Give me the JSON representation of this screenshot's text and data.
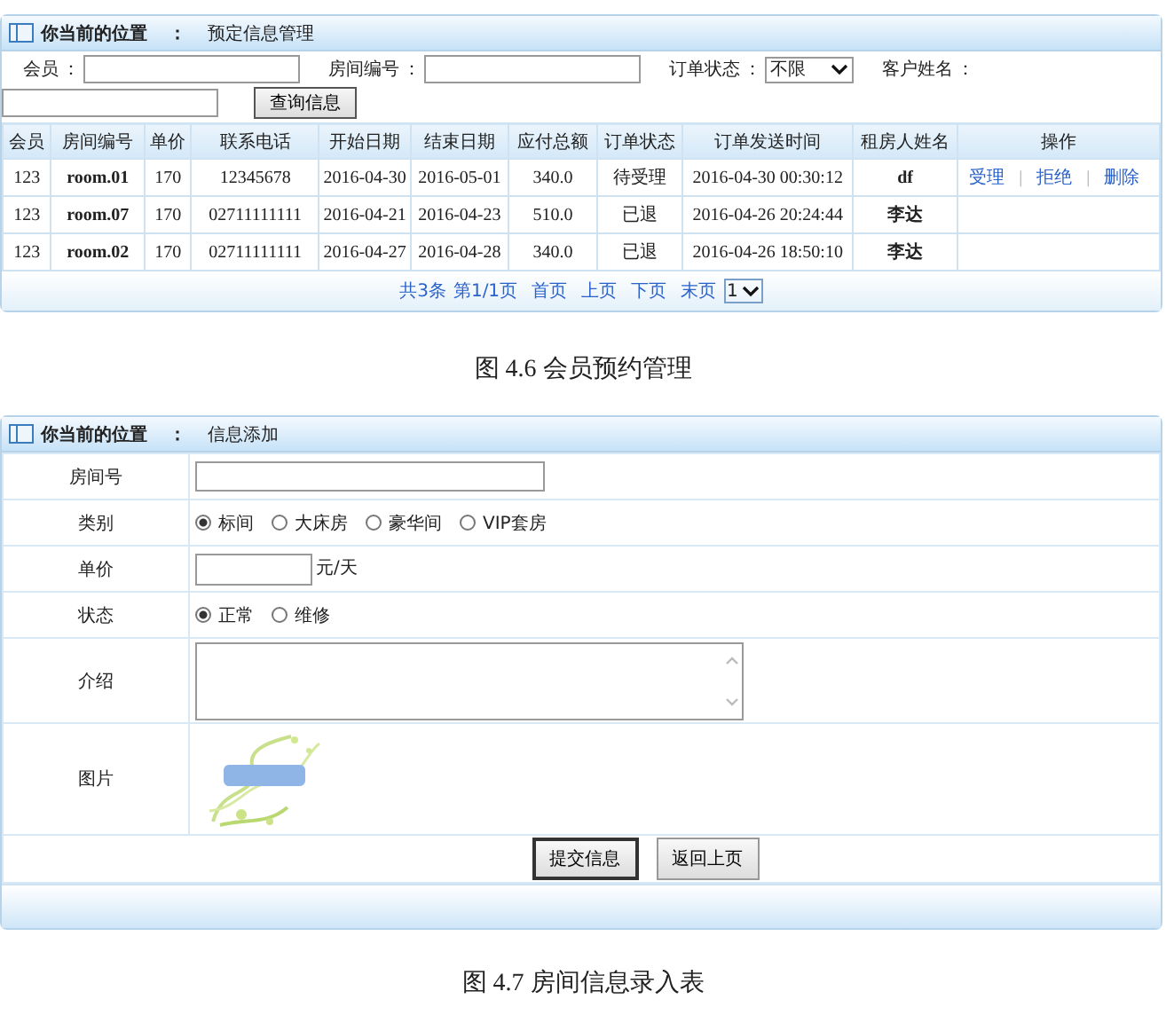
{
  "booking_panel": {
    "location_label": "你当前的位置",
    "location_sep": "：",
    "location": "预定信息管理",
    "filters": [
      {
        "kind": "text",
        "label": "会员",
        "sep": "："
      },
      {
        "kind": "text",
        "label": "房间编号",
        "sep": "："
      },
      {
        "kind": "select",
        "label": "订单状态",
        "sep": "：",
        "value": "不限"
      },
      {
        "kind": "text",
        "label": "客户姓名",
        "sep": "："
      }
    ],
    "query_button": "查询信息",
    "table": {
      "columns": [
        "会员",
        "房间编号",
        "单价",
        "联系电话",
        "开始日期",
        "结束日期",
        "应付总额",
        "订单状态",
        "订单发送时间",
        "租房人姓名",
        "操作"
      ],
      "rows": [
        {
          "cells": [
            "123",
            "room.01",
            "170",
            "12345678",
            "2016-04-30",
            "2016-05-01",
            "340.0",
            "待受理",
            "2016-04-30 00:30:12",
            "df"
          ],
          "actions": [
            {
              "kind": "link",
              "text": "受理"
            },
            {
              "kind": "separator",
              "text": "|"
            },
            {
              "kind": "link",
              "text": "拒绝"
            },
            {
              "kind": "separator",
              "text": "|"
            },
            {
              "kind": "link",
              "text": "删除"
            }
          ]
        },
        {
          "cells": [
            "123",
            "room.07",
            "170",
            "02711111111",
            "2016-04-21",
            "2016-04-23",
            "510.0",
            "已退",
            "2016-04-26 20:24:44",
            "李达"
          ],
          "actions": []
        },
        {
          "cells": [
            "123",
            "room.02",
            "170",
            "02711111111",
            "2016-04-27",
            "2016-04-28",
            "340.0",
            "已退",
            "2016-04-26 18:50:10",
            "李达"
          ],
          "actions": []
        }
      ]
    },
    "pagination": {
      "items": [
        "共3条",
        "第1/1页"
      ],
      "links": [
        "首页",
        "上页",
        "下页",
        "末页"
      ],
      "page_select": "1"
    }
  },
  "caption_1": "图 4.6  会员预约管理",
  "room_form": {
    "location_label": "你当前的位置",
    "location_sep": "：",
    "location": "信息添加",
    "rows": [
      {
        "kind": "text",
        "label": "房间号"
      },
      {
        "kind": "radio",
        "label": "类别",
        "options": [
          {
            "label": "标间",
            "selected": true
          },
          {
            "label": "大床房",
            "selected": false
          },
          {
            "label": "豪华间",
            "selected": false
          },
          {
            "label": "VIP套房",
            "selected": false
          }
        ]
      },
      {
        "kind": "price",
        "label": "单价",
        "unit": "元/天"
      },
      {
        "kind": "radio",
        "label": "状态",
        "options": [
          {
            "label": "正常",
            "selected": true
          },
          {
            "label": "维修",
            "selected": false
          }
        ]
      },
      {
        "kind": "textarea",
        "label": "介绍"
      },
      {
        "label": "图片"
      }
    ],
    "buttons": [
      {
        "label": "提交信息",
        "focused": true
      },
      {
        "label": "返回上页",
        "focused": false
      }
    ]
  },
  "caption_2": "图 4.7  房间信息录入表"
}
